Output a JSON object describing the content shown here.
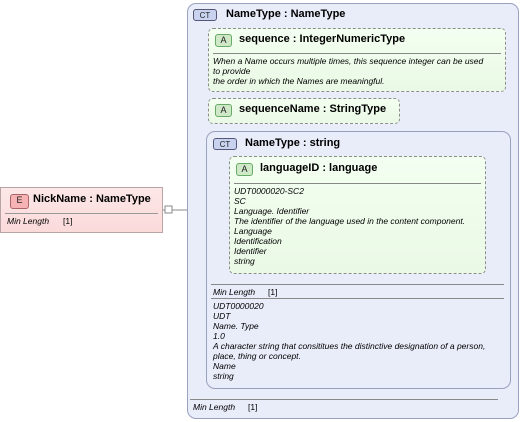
{
  "element": {
    "badge": "E",
    "title": "NickName : NameType",
    "facet_label": "Min Length",
    "facet_value": "[1]"
  },
  "complex_type_outer": {
    "badge": "CT",
    "title": "NameType : NameType",
    "facet_label": "Min Length",
    "facet_value": "[1]"
  },
  "attr_sequence": {
    "badge": "A",
    "title": "sequence : IntegerNumericType",
    "doc": [
      "When a Name occurs multiple times, this sequence integer can be used",
      "to provide",
      "the order in which the Names are meaningful."
    ]
  },
  "attr_sequence_name": {
    "badge": "A",
    "title": "sequenceName : StringType"
  },
  "complex_type_inner": {
    "badge": "CT",
    "title": "NameType : string",
    "facet_label": "Min Length",
    "facet_value": "[1]",
    "doc": [
      "UDT0000020",
      "UDT",
      "Name. Type",
      "1.0",
      "A character string that consititues the distinctive designation of a person,",
      "place, thing or concept.",
      "Name",
      "string"
    ]
  },
  "attr_language": {
    "badge": "A",
    "title": "languageID : language",
    "doc": [
      "UDT0000020-SC2",
      "SC",
      "Language. Identifier",
      "The identifier of the language used in the content component.",
      "Language",
      "Identification",
      "Identifier",
      "string"
    ]
  }
}
